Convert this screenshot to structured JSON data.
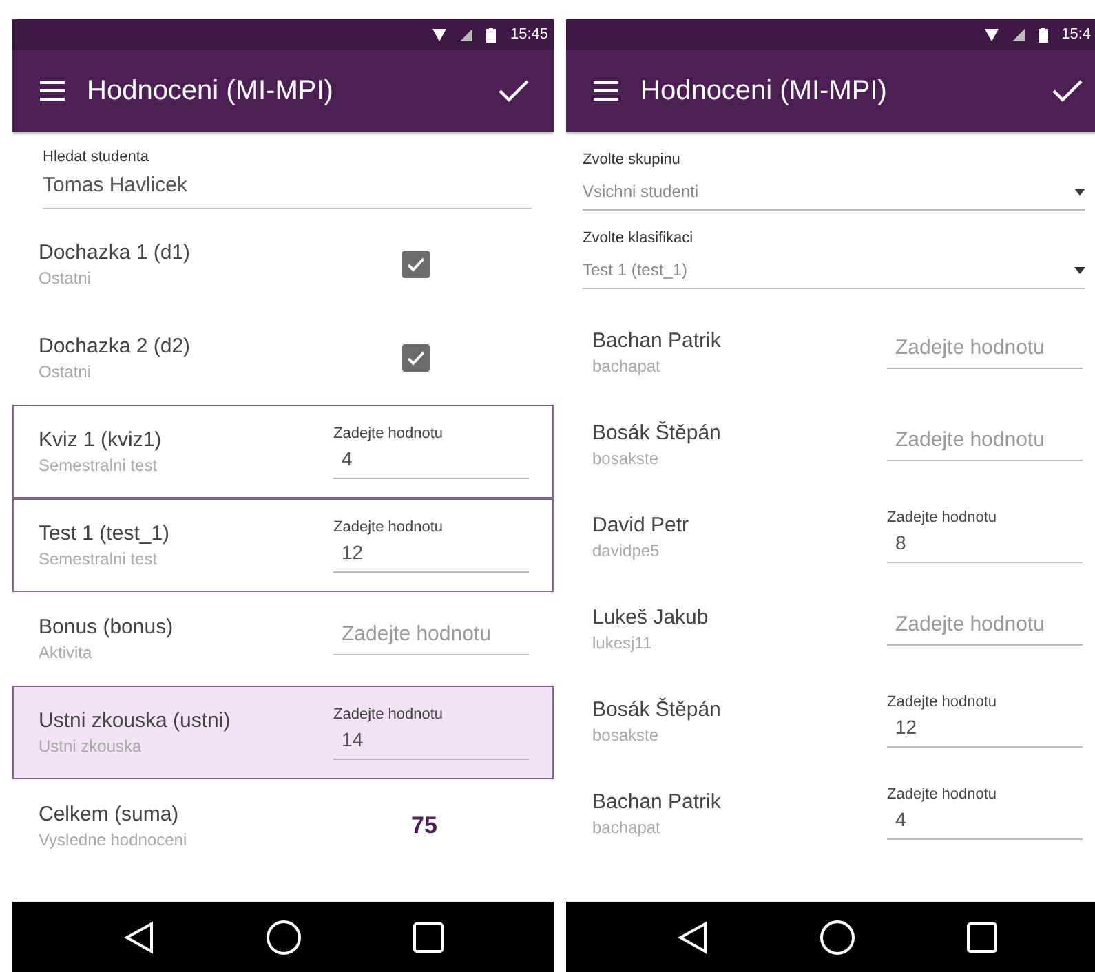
{
  "screens": [
    {
      "kind": "detail",
      "status_time": "15:45",
      "title": "Hodnoceni (MI-MPI)",
      "search": {
        "label": "Hledat studenta",
        "value": "Tomas Havlicek"
      },
      "rows": [
        {
          "kind": "checkbox",
          "title": "Dochazka 1 (d1)",
          "subtitle": "Ostatni",
          "checked": true,
          "outlined": false,
          "selected": false
        },
        {
          "kind": "checkbox",
          "title": "Dochazka 2 (d2)",
          "subtitle": "Ostatni",
          "checked": true,
          "outlined": false,
          "selected": false
        },
        {
          "kind": "input",
          "title": "Kviz 1 (kviz1)",
          "subtitle": "Semestralni test",
          "label": "Zadejte hodnotu",
          "value": "4",
          "outlined": true,
          "selected": false
        },
        {
          "kind": "input",
          "title": "Test 1 (test_1)",
          "subtitle": "Semestralni test",
          "label": "Zadejte hodnotu",
          "value": "12",
          "outlined": true,
          "selected": false
        },
        {
          "kind": "input",
          "title": "Bonus (bonus)",
          "subtitle": "Aktivita",
          "placeholder": "Zadejte hodnotu",
          "outlined": false,
          "selected": false
        },
        {
          "kind": "input",
          "title": "Ustni zkouska (ustni)",
          "subtitle": "Ustni zkouska",
          "label": "Zadejte hodnotu",
          "value": "14",
          "outlined": true,
          "selected": true
        },
        {
          "kind": "total",
          "title": "Celkem (suma)",
          "subtitle": "Vysledne hodnoceni",
          "value": "75",
          "outlined": false,
          "selected": false
        }
      ]
    },
    {
      "kind": "list",
      "status_time": "15:4",
      "title": "Hodnoceni (MI-MPI)",
      "selects": [
        {
          "label": "Zvolte skupinu",
          "value": "Vsichni studenti"
        },
        {
          "label": "Zvolte klasifikaci",
          "value": "Test 1 (test_1)"
        }
      ],
      "rows": [
        {
          "kind": "input",
          "title": "Bachan Patrik",
          "subtitle": "bachapat",
          "placeholder": "Zadejte hodnotu"
        },
        {
          "kind": "input",
          "title": "Bosák Štěpán",
          "subtitle": "bosakste",
          "placeholder": "Zadejte hodnotu"
        },
        {
          "kind": "input",
          "title": "David Petr",
          "subtitle": "davidpe5",
          "label": "Zadejte hodnotu",
          "value": "8"
        },
        {
          "kind": "input",
          "title": "Lukeš Jakub",
          "subtitle": "lukesj11",
          "placeholder": "Zadejte hodnotu"
        },
        {
          "kind": "input",
          "title": "Bosák Štěpán",
          "subtitle": "bosakste",
          "label": "Zadejte hodnotu",
          "value": "12"
        },
        {
          "kind": "input",
          "title": "Bachan Patrik",
          "subtitle": "bachapat",
          "label": "Zadejte hodnotu",
          "value": "4"
        }
      ]
    }
  ]
}
